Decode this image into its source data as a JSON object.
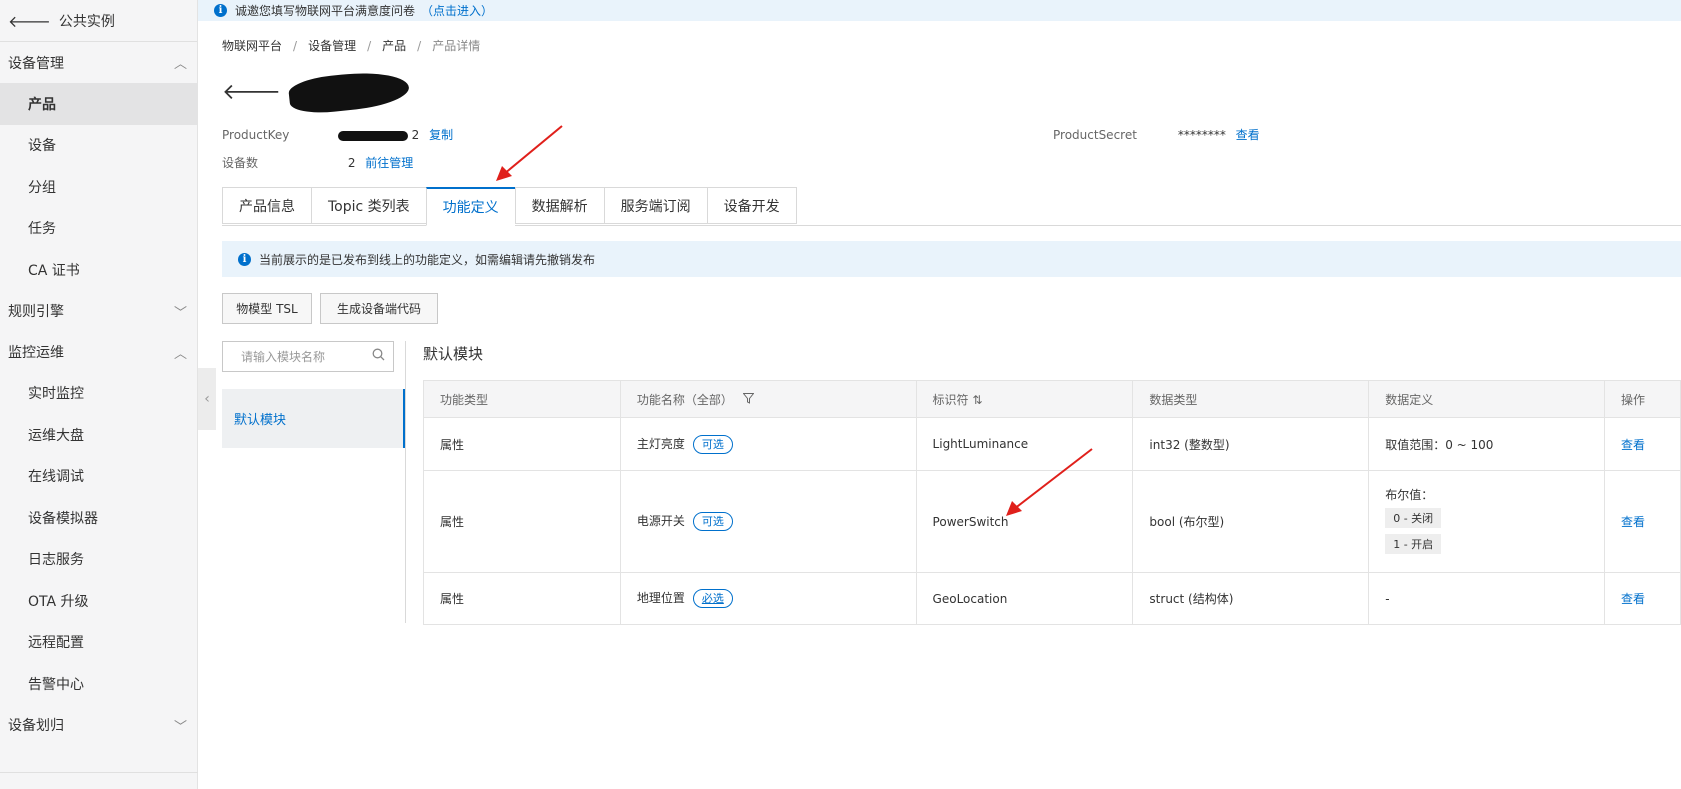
{
  "sidebar": {
    "back_label": "公共实例",
    "groups": [
      {
        "label": "设备管理",
        "expanded": true,
        "items": [
          "产品",
          "设备",
          "分组",
          "任务",
          "CA 证书"
        ]
      },
      {
        "label": "规则引擎",
        "expanded": false,
        "items": []
      },
      {
        "label": "监控运维",
        "expanded": true,
        "items": [
          "实时监控",
          "运维大盘",
          "在线调试",
          "设备模拟器",
          "日志服务",
          "OTA 升级",
          "远程配置",
          "告警中心"
        ]
      },
      {
        "label": "设备划归",
        "expanded": false,
        "items": []
      }
    ],
    "active_item": "产品"
  },
  "top_notice": {
    "text": "诚邀您填写物联网平台满意度问卷",
    "link": "（点击进入）"
  },
  "breadcrumb": [
    "物联网平台",
    "设备管理",
    "产品",
    "产品详情"
  ],
  "product": {
    "product_key_label": "ProductKey",
    "product_key_suffix": "2",
    "copy_label": "复制",
    "product_secret_label": "ProductSecret",
    "product_secret_value": "********",
    "view_label": "查看",
    "device_count_label": "设备数",
    "device_count": "2",
    "manage_label": "前往管理"
  },
  "tabs": [
    "产品信息",
    "Topic 类列表",
    "功能定义",
    "数据解析",
    "服务端订阅",
    "设备开发"
  ],
  "active_tab": "功能定义",
  "info_notice": "当前展示的是已发布到线上的功能定义，如需编辑请先撤销发布",
  "buttons": {
    "tsl": "物模型 TSL",
    "gen_code": "生成设备端代码"
  },
  "search": {
    "placeholder": "请输入模块名称"
  },
  "module_item": "默认模块",
  "module_title": "默认模块",
  "table": {
    "headers": [
      "功能类型",
      "功能名称（全部）",
      "标识符",
      "数据类型",
      "数据定义",
      "操作"
    ],
    "rows": [
      {
        "type": "属性",
        "name": "主灯亮度",
        "tag": "可选",
        "identifier": "LightLuminance",
        "data_type": "int32 (整数型)",
        "definition": "取值范围：0 ~ 100",
        "action": "查看"
      },
      {
        "type": "属性",
        "name": "电源开关",
        "tag": "可选",
        "identifier": "PowerSwitch",
        "data_type": "bool (布尔型)",
        "definition_title": "布尔值：",
        "bool_values": [
          "0 - 关闭",
          "1 - 开启"
        ],
        "action": "查看"
      },
      {
        "type": "属性",
        "name": "地理位置",
        "tag": "必选",
        "identifier": "GeoLocation",
        "data_type": "struct (结构体)",
        "definition": "-",
        "action": "查看"
      }
    ]
  },
  "colors": {
    "accent": "#0070cc",
    "annotation": "#e0201b",
    "sidebar_bg": "#f5f5f6",
    "notice_bg": "#e9f3fb"
  }
}
